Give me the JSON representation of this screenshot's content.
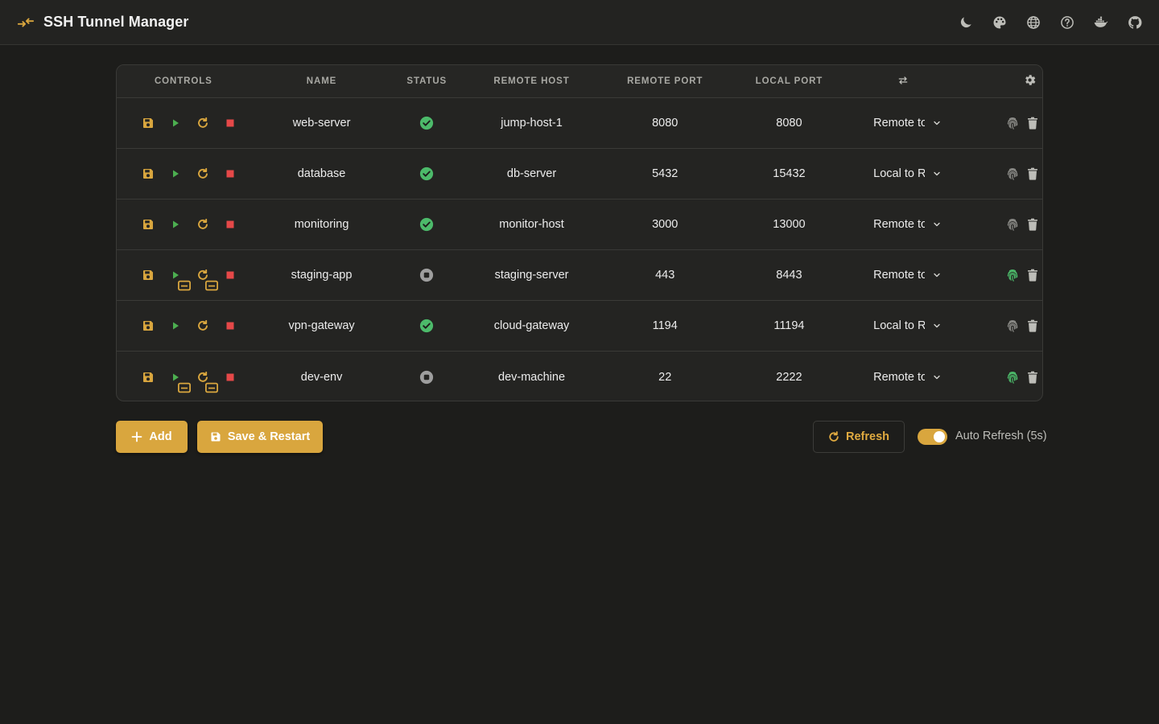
{
  "app": {
    "title": "SSH Tunnel Manager"
  },
  "top_icons": [
    "moon-icon",
    "palette-icon",
    "globe-icon",
    "help-icon",
    "docker-icon",
    "github-icon"
  ],
  "table": {
    "headers": {
      "controls": "CONTROLS",
      "name": "NAME",
      "status": "STATUS",
      "remote_host": "REMOTE HOST",
      "remote_port": "REMOTE PORT",
      "local_port": "LOCAL PORT"
    },
    "rows": [
      {
        "name": "web-server",
        "status": "running",
        "remote_host": "jump-host-1",
        "remote_port": "8080",
        "local_port": "8080",
        "direction": "Remote to Local",
        "autostart": false,
        "fingerprint": "grey"
      },
      {
        "name": "database",
        "status": "running",
        "remote_host": "db-server",
        "remote_port": "5432",
        "local_port": "15432",
        "direction": "Local to Remote",
        "autostart": false,
        "fingerprint": "grey"
      },
      {
        "name": "monitoring",
        "status": "running",
        "remote_host": "monitor-host",
        "remote_port": "3000",
        "local_port": "13000",
        "direction": "Remote to Local",
        "autostart": false,
        "fingerprint": "grey"
      },
      {
        "name": "staging-app",
        "status": "stopped",
        "remote_host": "staging-server",
        "remote_port": "443",
        "local_port": "8443",
        "direction": "Remote to Local",
        "autostart": true,
        "fingerprint": "green"
      },
      {
        "name": "vpn-gateway",
        "status": "running",
        "remote_host": "cloud-gateway",
        "remote_port": "1194",
        "local_port": "11194",
        "direction": "Local to Remote",
        "autostart": false,
        "fingerprint": "grey"
      },
      {
        "name": "dev-env",
        "status": "stopped",
        "remote_host": "dev-machine",
        "remote_port": "22",
        "local_port": "2222",
        "direction": "Remote to Local",
        "autostart": true,
        "fingerprint": "green"
      }
    ]
  },
  "actions": {
    "add_label": "Add",
    "save_restart_label": "Save & Restart",
    "refresh_label": "Refresh",
    "auto_refresh_label": "Auto Refresh (5s)",
    "auto_refresh_enabled": true
  },
  "colors": {
    "accent": "#d9a63e",
    "play": "#4caf50",
    "stop": "#e54848",
    "status_ok": "#4cba6a",
    "status_stopped": "#9e9e9e",
    "background": "#1d1d1b"
  }
}
